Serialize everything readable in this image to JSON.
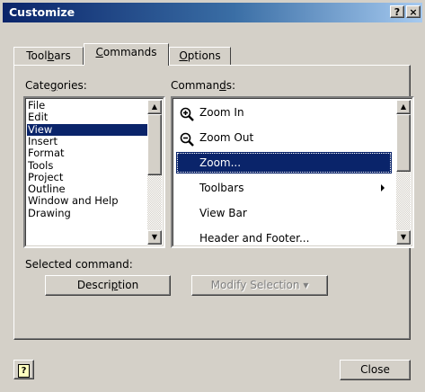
{
  "window": {
    "title": "Customize",
    "help_btn": "?",
    "close_btn": "×"
  },
  "tabs": [
    {
      "pre": "Tool",
      "u": "b",
      "post": "ars"
    },
    {
      "pre": "",
      "u": "C",
      "post": "ommands"
    },
    {
      "pre": "",
      "u": "O",
      "post": "ptions"
    }
  ],
  "categories": {
    "label_pre": "Cate",
    "label_u": "g",
    "label_post": "ories:",
    "items": [
      "File",
      "Edit",
      "View",
      "Insert",
      "Format",
      "Tools",
      "Project",
      "Outline",
      "Window and Help",
      "Drawing"
    ],
    "selected": "View"
  },
  "commands": {
    "label_pre": "Comman",
    "label_u": "d",
    "label_post": "s:",
    "items": [
      {
        "label": "Zoom In",
        "icon": "zoom-in-icon"
      },
      {
        "label": "Zoom Out",
        "icon": "zoom-out-icon"
      },
      {
        "label": "Zoom...",
        "icon": ""
      },
      {
        "label": "Toolbars",
        "icon": "",
        "submenu": true
      },
      {
        "label": "View Bar",
        "icon": ""
      },
      {
        "label": "Header and Footer...",
        "icon": ""
      }
    ],
    "selected": "Zoom..."
  },
  "selected_command_label": "Selected command:",
  "buttons": {
    "description_pre": "Descri",
    "description_u": "p",
    "description_post": "tion",
    "modify_selection": "Modify Selection",
    "modify_arrow": "▾",
    "close": "Close",
    "help_icon": "?"
  },
  "colors": {
    "selection": "#0a246a",
    "face": "#d4d0c8"
  }
}
